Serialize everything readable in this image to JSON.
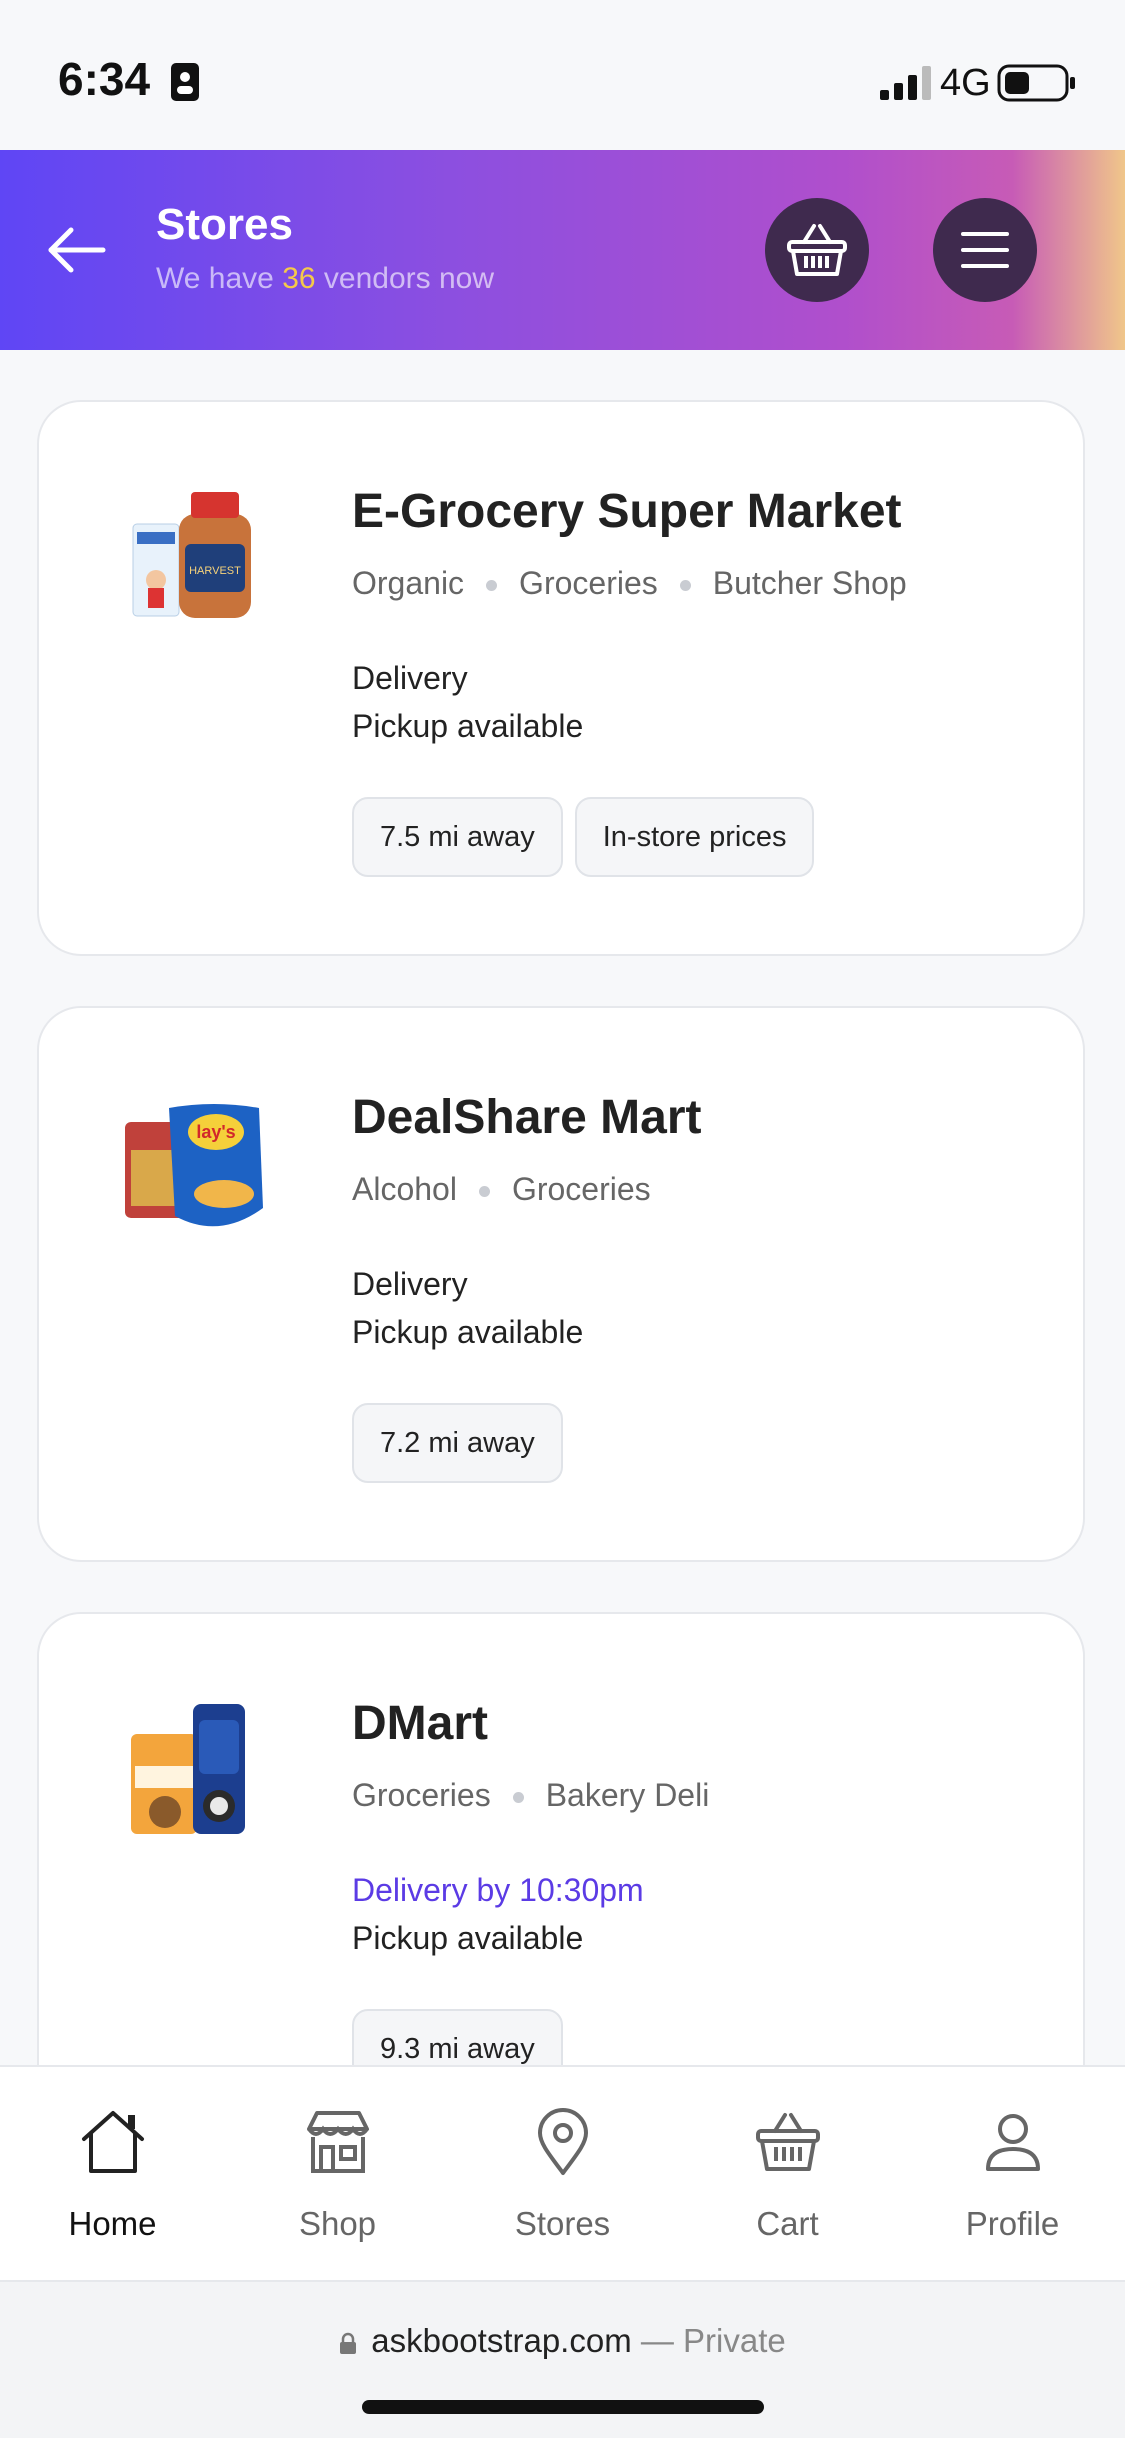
{
  "status_bar": {
    "time": "6:34",
    "network": "4G"
  },
  "header": {
    "title": "Stores",
    "subtitle_prefix": "We have",
    "vendor_count": "36",
    "subtitle_suffix": "vendors now"
  },
  "stores": [
    {
      "name": "E-Grocery Super Market",
      "categories": [
        "Organic",
        "Groceries",
        "Butcher Shop"
      ],
      "delivery": "Delivery",
      "pickup": "Pickup available",
      "chips": [
        "7.5 mi away",
        "In-store prices"
      ]
    },
    {
      "name": "DealShare Mart",
      "categories": [
        "Alcohol",
        "Groceries"
      ],
      "delivery": "Delivery",
      "pickup": "Pickup available",
      "chips": [
        "7.2 mi away"
      ]
    },
    {
      "name": "DMart",
      "categories": [
        "Groceries",
        "Bakery Deli"
      ],
      "delivery": "Delivery by 10:30pm",
      "pickup": "Pickup available",
      "chips": [
        "9.3 mi away"
      ]
    }
  ],
  "nav": [
    {
      "label": "Home",
      "icon": "home-icon",
      "active": true
    },
    {
      "label": "Shop",
      "icon": "shop-icon",
      "active": false
    },
    {
      "label": "Stores",
      "icon": "location-pin-icon",
      "active": false
    },
    {
      "label": "Cart",
      "icon": "basket-icon",
      "active": false
    },
    {
      "label": "Profile",
      "icon": "user-icon",
      "active": false
    }
  ],
  "browser": {
    "domain": "askbootstrap.com",
    "mode": "— Private"
  },
  "colors": {
    "accent": "#5b3be5",
    "highlight": "#f5c94a",
    "button_dark": "#3f2a4e"
  }
}
